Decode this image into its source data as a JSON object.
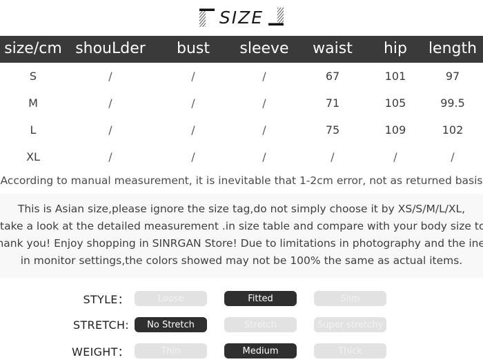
{
  "title": {
    "text": "SIZE",
    "left_bracket_icon": "hatched-corner-bracket-left-icon",
    "right_bracket_icon": "hatched-corner-bracket-right-icon"
  },
  "table": {
    "columns": [
      "size/cm",
      "shouLder",
      "bust",
      "sleeve",
      "waist",
      "hip",
      "length"
    ],
    "rows": [
      {
        "size": "S",
        "shoulder": "/",
        "bust": "/",
        "sleeve": "/",
        "waist": "67",
        "hip": "101",
        "length": "97"
      },
      {
        "size": "M",
        "shoulder": "/",
        "bust": "/",
        "sleeve": "/",
        "waist": "71",
        "hip": "105",
        "length": "99.5"
      },
      {
        "size": "L",
        "shoulder": "/",
        "bust": "/",
        "sleeve": "/",
        "waist": "75",
        "hip": "109",
        "length": "102"
      },
      {
        "size": "XL",
        "shoulder": "/",
        "bust": "/",
        "sleeve": "/",
        "waist": "/",
        "hip": "/",
        "length": "/"
      }
    ]
  },
  "manual_note": "According to manual measurement, it is inevitable that 1-2cm error, not as returned basis",
  "info_block": {
    "line1": "This is Asian size,please ignore the size tag,do not simply choose it by XS/S/M/L/XL,",
    "line2": "take a look at the detailed measurement .in size table and compare with your body size to get the right fit.",
    "line3": "Thank you! Enjoy shopping in SINRGAN Store!  Due to limitations in photography and the inevitable differences",
    "line4": "in monitor settings,the colors showed may not be 100% the same as actual items."
  },
  "attributes": [
    {
      "label": "STYLE：",
      "options": [
        {
          "label": "Loose",
          "selected": false
        },
        {
          "label": "Fitted",
          "selected": true
        },
        {
          "label": "Slim",
          "selected": false
        }
      ]
    },
    {
      "label": "STRETCH:",
      "options": [
        {
          "label": "No Stretch",
          "selected": true
        },
        {
          "label": "Stretch",
          "selected": false
        },
        {
          "label": "Super stretchy",
          "selected": false
        }
      ]
    },
    {
      "label": "WEIGHT：",
      "options": [
        {
          "label": "Thin",
          "selected": false
        },
        {
          "label": "Medium",
          "selected": true
        },
        {
          "label": "Thick",
          "selected": false
        }
      ]
    }
  ],
  "colors": {
    "header_bar": "#3a3a3a",
    "selected_chip": "#2f2f2f",
    "unselected_chip": "#e2e2e2",
    "info_block_bg": "#f8f8f8",
    "page_bg": "#ffffff"
  }
}
